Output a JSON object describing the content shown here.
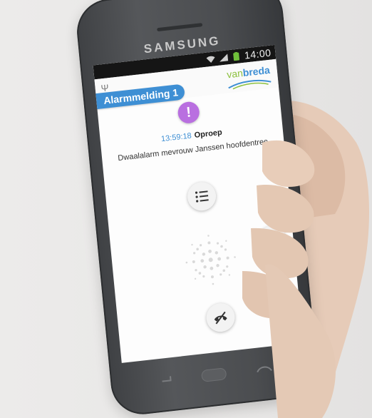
{
  "device": {
    "brand": "SAMSUNG"
  },
  "status_bar": {
    "time": "14:00",
    "icons": [
      "wifi-icon",
      "signal-icon",
      "battery-icon"
    ]
  },
  "app": {
    "title": "Alarmmelding 1",
    "logo": {
      "prefix": "van",
      "name": "breda"
    },
    "alert": {
      "badge": "!",
      "badge_color": "#b96fe0",
      "time": "13:59:18",
      "type": "Oproep",
      "message": "Dwaalalarm mevrouw Janssen hoofdentree"
    },
    "actions": [
      {
        "name": "details",
        "icon": "list-icon"
      },
      {
        "name": "accept-call",
        "icon": "phone-icon"
      },
      {
        "name": "hang-up",
        "icon": "hang-up-icon"
      }
    ]
  },
  "colors": {
    "accent": "#3e8fd4",
    "logo_green": "#8dc13f",
    "phone_body": "#4b4d50"
  }
}
